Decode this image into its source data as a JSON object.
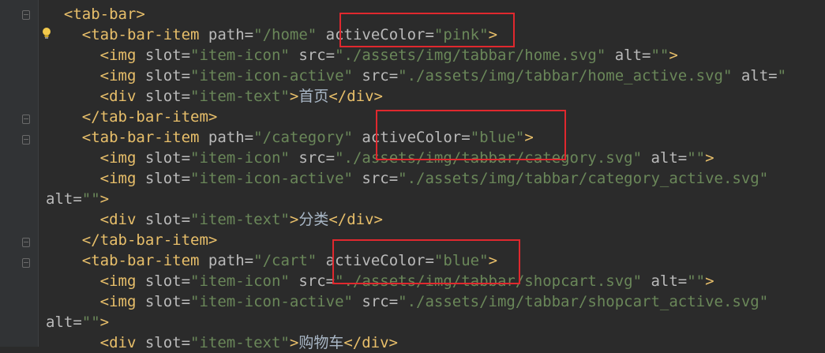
{
  "lines": [
    {
      "indent": "  ",
      "segments": [
        {
          "t": "tag",
          "v": "<tab-bar>"
        }
      ]
    },
    {
      "indent": "    ",
      "segments": [
        {
          "t": "tag",
          "v": "<tab-bar-item "
        },
        {
          "t": "attr",
          "v": "path="
        },
        {
          "t": "val",
          "v": "\"/home\" "
        },
        {
          "t": "attr",
          "v": "activeColor="
        },
        {
          "t": "val",
          "v": "\"pink\""
        },
        {
          "t": "tag",
          "v": ">"
        }
      ]
    },
    {
      "indent": "      ",
      "segments": [
        {
          "t": "tag",
          "v": "<img "
        },
        {
          "t": "attr",
          "v": "slot="
        },
        {
          "t": "val",
          "v": "\"item-icon\" "
        },
        {
          "t": "attr",
          "v": "src="
        },
        {
          "t": "val",
          "v": "\"./assets/img/tabbar/home.svg\" "
        },
        {
          "t": "attr",
          "v": "alt="
        },
        {
          "t": "val",
          "v": "\"\""
        },
        {
          "t": "tag",
          "v": ">"
        }
      ]
    },
    {
      "indent": "      ",
      "segments": [
        {
          "t": "tag",
          "v": "<img "
        },
        {
          "t": "attr",
          "v": "slot="
        },
        {
          "t": "val",
          "v": "\"item-icon-active\" "
        },
        {
          "t": "attr",
          "v": "src="
        },
        {
          "t": "val",
          "v": "\"./assets/img/tabbar/home_active.svg\" "
        },
        {
          "t": "attr",
          "v": "alt="
        },
        {
          "t": "val",
          "v": "\""
        }
      ]
    },
    {
      "indent": "      ",
      "segments": [
        {
          "t": "tag",
          "v": "<div "
        },
        {
          "t": "attr",
          "v": "slot="
        },
        {
          "t": "val",
          "v": "\"item-text\""
        },
        {
          "t": "tag",
          "v": ">"
        },
        {
          "t": "txt",
          "v": "首页"
        },
        {
          "t": "tag",
          "v": "</div>"
        }
      ]
    },
    {
      "indent": "    ",
      "segments": [
        {
          "t": "tag",
          "v": "</tab-bar-item>"
        }
      ]
    },
    {
      "indent": "    ",
      "segments": [
        {
          "t": "tag",
          "v": "<tab-bar-item "
        },
        {
          "t": "attr",
          "v": "path="
        },
        {
          "t": "val",
          "v": "\"/category\" "
        },
        {
          "t": "attr",
          "v": "activeColor="
        },
        {
          "t": "val",
          "v": "\"blue\""
        },
        {
          "t": "tag",
          "v": ">"
        }
      ]
    },
    {
      "indent": "      ",
      "segments": [
        {
          "t": "tag",
          "v": "<img "
        },
        {
          "t": "attr",
          "v": "slot="
        },
        {
          "t": "val",
          "v": "\"item-icon\" "
        },
        {
          "t": "attr",
          "v": "src="
        },
        {
          "t": "val",
          "v": "\"./assets/img/tabbar/category.svg\" "
        },
        {
          "t": "attr",
          "v": "alt="
        },
        {
          "t": "val",
          "v": "\"\""
        },
        {
          "t": "tag",
          "v": ">"
        }
      ]
    },
    {
      "indent": "      ",
      "segments": [
        {
          "t": "tag",
          "v": "<img "
        },
        {
          "t": "attr",
          "v": "slot="
        },
        {
          "t": "val",
          "v": "\"item-icon-active\" "
        },
        {
          "t": "attr",
          "v": "src="
        },
        {
          "t": "val",
          "v": "\"./assets/img/tabbar/category_active.svg\""
        }
      ]
    },
    {
      "indent": "",
      "segments": [
        {
          "t": "attr",
          "v": "alt="
        },
        {
          "t": "val",
          "v": "\"\""
        },
        {
          "t": "tag",
          "v": ">"
        }
      ]
    },
    {
      "indent": "      ",
      "segments": [
        {
          "t": "tag",
          "v": "<div "
        },
        {
          "t": "attr",
          "v": "slot="
        },
        {
          "t": "val",
          "v": "\"item-text\""
        },
        {
          "t": "tag",
          "v": ">"
        },
        {
          "t": "txt",
          "v": "分类"
        },
        {
          "t": "tag",
          "v": "</div>"
        }
      ]
    },
    {
      "indent": "    ",
      "segments": [
        {
          "t": "tag",
          "v": "</tab-bar-item>"
        }
      ]
    },
    {
      "indent": "    ",
      "segments": [
        {
          "t": "tag",
          "v": "<tab-bar-item "
        },
        {
          "t": "attr",
          "v": "path="
        },
        {
          "t": "val",
          "v": "\"/cart\" "
        },
        {
          "t": "attr",
          "v": "activeColor="
        },
        {
          "t": "val",
          "v": "\"blue\""
        },
        {
          "t": "tag",
          "v": ">"
        }
      ]
    },
    {
      "indent": "      ",
      "segments": [
        {
          "t": "tag",
          "v": "<img "
        },
        {
          "t": "attr",
          "v": "slot="
        },
        {
          "t": "val",
          "v": "\"item-icon\" "
        },
        {
          "t": "attr",
          "v": "src="
        },
        {
          "t": "val",
          "v": "\"./assets/img/tabbar/shopcart.svg\" "
        },
        {
          "t": "attr",
          "v": "alt="
        },
        {
          "t": "val",
          "v": "\"\""
        },
        {
          "t": "tag",
          "v": ">"
        }
      ]
    },
    {
      "indent": "      ",
      "segments": [
        {
          "t": "tag",
          "v": "<img "
        },
        {
          "t": "attr",
          "v": "slot="
        },
        {
          "t": "val",
          "v": "\"item-icon-active\" "
        },
        {
          "t": "attr",
          "v": "src="
        },
        {
          "t": "val",
          "v": "\"./assets/img/tabbar/shopcart_active.svg\""
        }
      ]
    },
    {
      "indent": "",
      "segments": [
        {
          "t": "attr",
          "v": "alt="
        },
        {
          "t": "val",
          "v": "\"\""
        },
        {
          "t": "tag",
          "v": ">"
        }
      ]
    },
    {
      "indent": "      ",
      "segments": [
        {
          "t": "tag",
          "v": "<div "
        },
        {
          "t": "attr",
          "v": "slot="
        },
        {
          "t": "val",
          "v": "\"item-text\""
        },
        {
          "t": "tag",
          "v": ">"
        },
        {
          "t": "txt",
          "v": "购物车"
        },
        {
          "t": "tag",
          "v": "</div>"
        }
      ]
    }
  ],
  "colors": {
    "background": "#2b2b2b",
    "tag": "#e8bf6a",
    "attribute": "#bababa",
    "value": "#6a8759",
    "highlight_box": "#e0282e"
  },
  "icons": {
    "intention_bulb": "lightbulb-icon",
    "fold_markers": "fold-marker-icon"
  }
}
